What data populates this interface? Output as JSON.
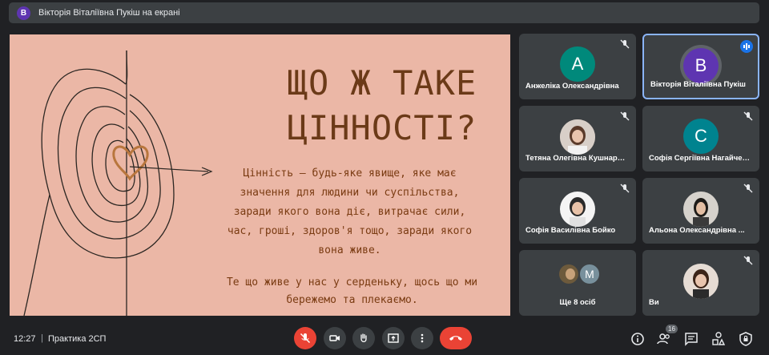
{
  "topbar": {
    "avatar_letter": "В",
    "presenter_label": "Вікторія Віталіївна Пукіш на екрані"
  },
  "slide": {
    "heading_line1": "ЩО Ж ТАКЕ",
    "heading_line2": "ЦІННОСТІ?",
    "body_lines": [
      "Цінність — будь-яке явище, яке має",
      "значення для людини чи суспільства,",
      "заради якого вона діє, витрачає сили,",
      "час, гроші, здоров'я тощо, заради якого",
      "вона живе."
    ],
    "body2_lines": [
      "Те що живе у нас у серденьку, щось що ми",
      "бережемо та плекаємо."
    ]
  },
  "participants": [
    {
      "name": "Анжеліка Олександрівна",
      "letter": "А",
      "color": "#00897b"
    },
    {
      "name": "Вікторія Віталіївна Пукіш",
      "letter": "В",
      "color": "#5e35b1"
    },
    {
      "name": "Тетяна Олегівна Кушнарьова"
    },
    {
      "name": "Софія Сергіївна Нагайченко",
      "letter": "С",
      "color": "#00838f"
    },
    {
      "name": "Софія Василівна Бойко"
    },
    {
      "name": "Альона Олександрівна ..."
    },
    {
      "name": "Ще 8 осіб",
      "letter": "М"
    },
    {
      "name": "Ви"
    }
  ],
  "bottom": {
    "time": "12:27",
    "separator": "|",
    "meeting_name": "Практика 2СП",
    "people_count": "16"
  }
}
